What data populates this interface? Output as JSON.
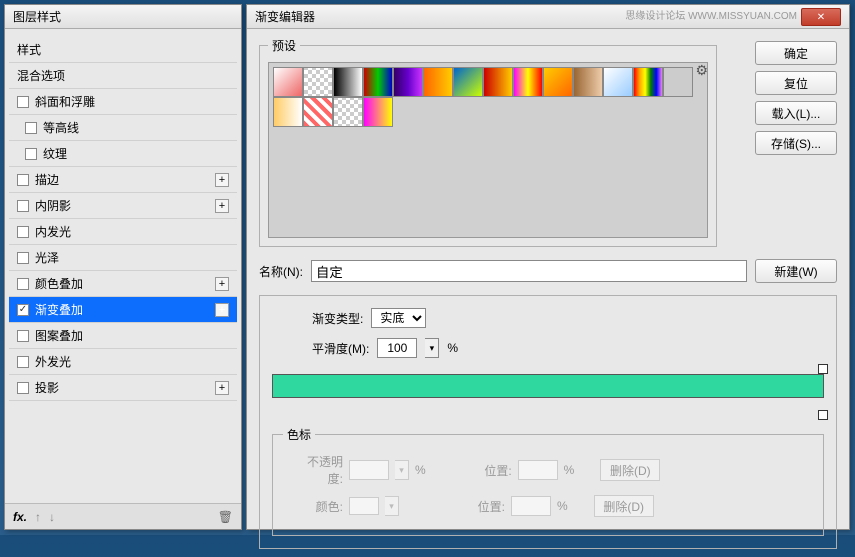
{
  "left_dialog": {
    "title": "图层样式",
    "styles_header": "样式",
    "blend_options": "混合选项",
    "items": [
      {
        "label": "斜面和浮雕",
        "checked": false,
        "has_plus": false
      },
      {
        "label": "等高线",
        "checked": false,
        "has_plus": false,
        "sub": true
      },
      {
        "label": "纹理",
        "checked": false,
        "has_plus": false,
        "sub": true
      },
      {
        "label": "描边",
        "checked": false,
        "has_plus": true
      },
      {
        "label": "内阴影",
        "checked": false,
        "has_plus": true
      },
      {
        "label": "内发光",
        "checked": false,
        "has_plus": false
      },
      {
        "label": "光泽",
        "checked": false,
        "has_plus": false
      },
      {
        "label": "颜色叠加",
        "checked": false,
        "has_plus": true
      },
      {
        "label": "渐变叠加",
        "checked": true,
        "has_plus": true,
        "selected": true
      },
      {
        "label": "图案叠加",
        "checked": false,
        "has_plus": false
      },
      {
        "label": "外发光",
        "checked": false,
        "has_plus": false
      },
      {
        "label": "投影",
        "checked": false,
        "has_plus": true
      }
    ],
    "fx_label": "fx."
  },
  "right_dialog": {
    "title": "渐变编辑器",
    "watermark": "思缘设计论坛   WWW.MISSYUAN.COM",
    "presets_label": "预设",
    "buttons": {
      "ok": "确定",
      "reset": "复位",
      "load": "载入(L)...",
      "save": "存储(S)...",
      "new": "新建(W)"
    },
    "name_label": "名称(N):",
    "name_value": "自定",
    "type_label": "渐变类型:",
    "type_value": "实底",
    "smooth_label": "平滑度(M):",
    "smooth_value": "100",
    "percent": "%",
    "gradient_color": "#2fd89f",
    "stops_label": "色标",
    "opacity_label": "不透明度:",
    "color_label": "颜色:",
    "position_label": "位置:",
    "delete_label": "删除(D)"
  }
}
